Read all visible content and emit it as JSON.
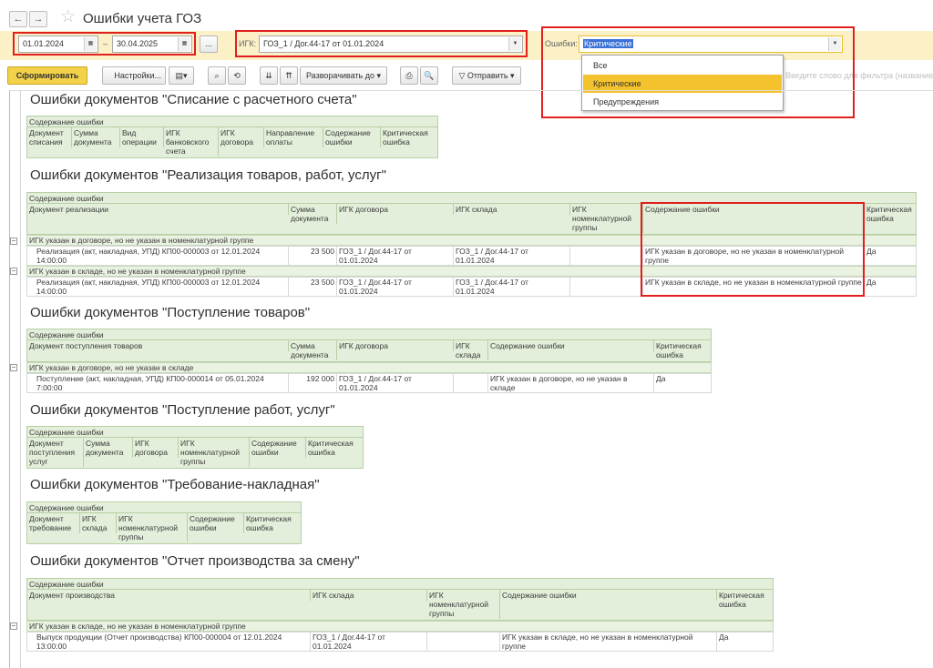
{
  "window": {
    "title": "Ошибки учета ГОЗ",
    "back_icon": "←",
    "forward_icon": "→"
  },
  "filters": {
    "date_from": "01.01.2024",
    "date_to": "30.04.2025",
    "date_sep": "–",
    "dots": "...",
    "igk_label": "ИГК:",
    "igk_value": "ГОЗ_1 / Дог.44-17 от 01.01.2024",
    "err_label": "Ошибки:",
    "err_value": "Критические"
  },
  "dropdown": {
    "options": [
      "Все",
      "Критические",
      "Предупреждения"
    ],
    "selected": "Критические"
  },
  "toolbar": {
    "generate": "Сформировать",
    "settings": "Настройки...",
    "expand": "Разворачивать до",
    "send": "Отправить"
  },
  "search_hint": "Введите слово для фильтра (название т",
  "report": {
    "s1": {
      "title": "Ошибки документов \"Списание с расчетного счета\"",
      "cap": "Содержание ошибки",
      "cols": [
        "Документ\nсписания",
        "Сумма\nдокумента",
        "Вид\nоперации",
        "ИГК\nбанковского\nсчета",
        "ИГК\nдоговора",
        "Направление\nоплаты",
        "Содержание\nошибки",
        "Критическая\nошибка"
      ]
    },
    "s2": {
      "title": "Ошибки документов \"Реализация товаров, работ, услуг\"",
      "cap": "Содержание ошибки",
      "cols": [
        "Документ реализации",
        "Сумма\nдокумента",
        "ИГК договора",
        "ИГК склада",
        "ИГК\nноменклатурной\nгруппы",
        "Содержание ошибки",
        "Критическая\nошибка"
      ],
      "g1": "ИГК указан в договоре, но не указан в номенклатурной группе",
      "r1": [
        "Реализация (акт, накладная, УПД) КП00-000003 от 12.01.2024\n14:00:00",
        "23 500",
        "ГОЗ_1 / Дог.44-17 от\n01.01.2024",
        "ГОЗ_1 / Дог.44-17 от\n01.01.2024",
        "",
        "ИГК указан в договоре, но не указан в номенклатурной\nгруппе",
        "Да"
      ],
      "g2": "ИГК указан в складе, но не указан в номенклатурной группе",
      "r2": [
        "Реализация (акт, накладная, УПД) КП00-000003 от 12.01.2024\n14:00:00",
        "23 500",
        "ГОЗ_1 / Дог.44-17 от\n01.01.2024",
        "ГОЗ_1 / Дог.44-17 от\n01.01.2024",
        "",
        "ИГК указан в складе, но не указан в номенклатурной группе",
        "Да"
      ]
    },
    "s3": {
      "title": "Ошибки документов \"Поступление товаров\"",
      "cap": "Содержание ошибки",
      "cols": [
        "Документ поступления товаров",
        "Сумма\nдокумента",
        "ИГК договора",
        "ИГК\nсклада",
        "Содержание ошибки",
        "Критическая\nошибка"
      ],
      "g1": "ИГК указан в договоре, но не указан в складе",
      "r1": [
        "Поступление (акт, накладная, УПД) КП00-000014 от 05.01.2024\n7:00:00",
        "192 000",
        "ГОЗ_1 / Дог.44-17 от\n01.01.2024",
        "",
        "ИГК указан в договоре, но не указан в\nскладе",
        "Да"
      ]
    },
    "s4": {
      "title": "Ошибки документов \"Поступление работ, услуг\"",
      "cap": "Содержание ошибки",
      "cols": [
        "Документ\nпоступления\nуслуг",
        "Сумма\nдокумента",
        "ИГК\nдоговора",
        "ИГК\nноменклатурной\nгруппы",
        "Содержание\nошибки",
        "Критическая\nошибка"
      ]
    },
    "s5": {
      "title": "Ошибки документов \"Требование-накладная\"",
      "cap": "Содержание ошибки",
      "cols": [
        "Документ\nтребование",
        "ИГК\nсклада",
        "ИГК\nноменклатурной\nгруппы",
        "Содержание\nошибки",
        "Критическая\nошибка"
      ]
    },
    "s6": {
      "title": "Ошибки документов \"Отчет производства за смену\"",
      "cap": "Содержание ошибки",
      "cols": [
        "Документ производства",
        "ИГК склада",
        "ИГК\nноменклатурной\nгруппы",
        "Содержание ошибки",
        "Критическая\nошибка"
      ],
      "g1": "ИГК указан в складе, но не указан в номенклатурной группе",
      "r1": [
        "Выпуск продукции (Отчет производства) КП00-000004 от 12.01.2024\n13:00:00",
        "ГОЗ_1 / Дог.44-17 от\n01.01.2024",
        "",
        "ИГК указан в складе, но не указан в номенклатурной\nгруппе",
        "Да"
      ]
    }
  },
  "colors": {
    "filter_bar": "#fbf0c6",
    "highlight": "#e0201d",
    "header_bg": "#e3efda",
    "selected_option": "#f3c22d",
    "primary_button": "#f3d24a"
  }
}
